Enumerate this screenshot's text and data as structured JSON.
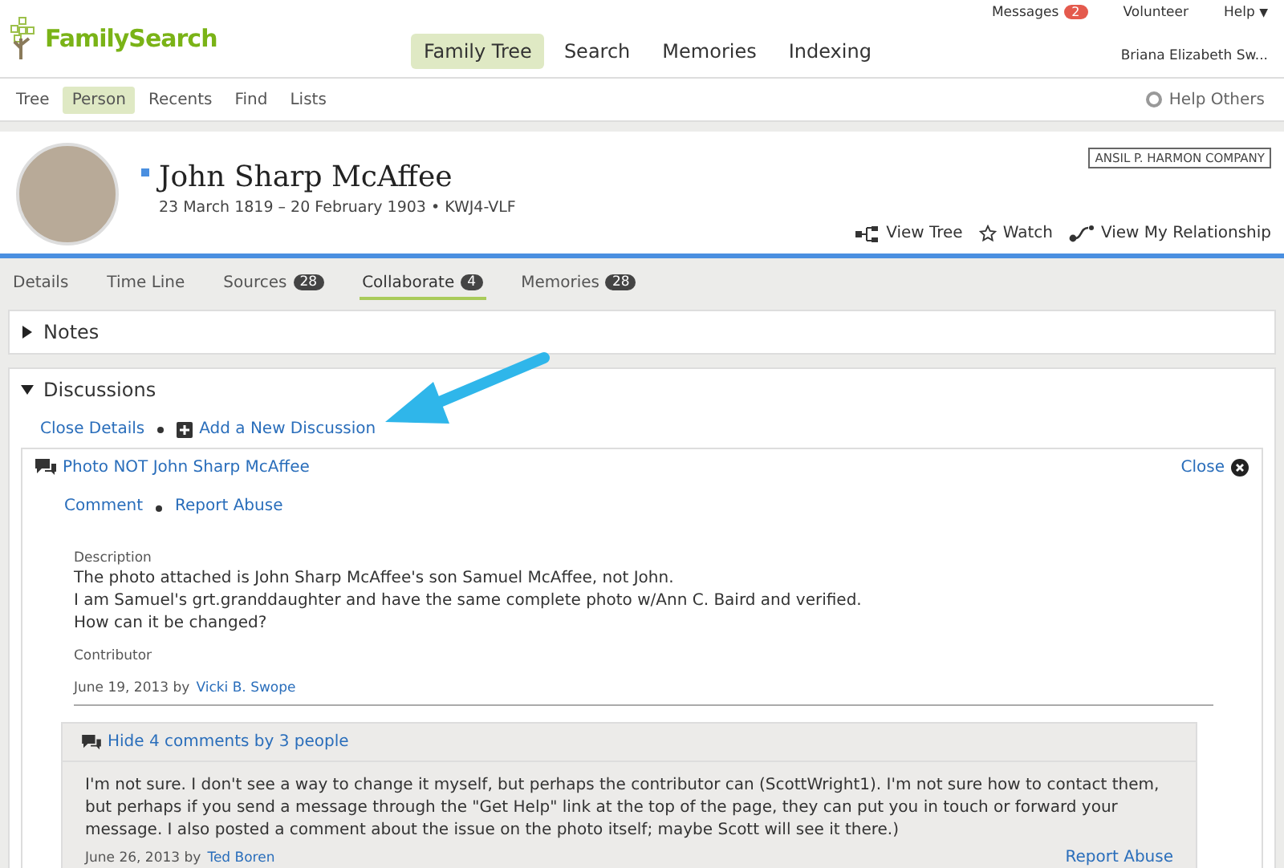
{
  "header": {
    "logo": "FamilySearch",
    "nav": [
      {
        "label": "Family Tree",
        "selected": true
      },
      {
        "label": "Search",
        "selected": false
      },
      {
        "label": "Memories",
        "selected": false
      },
      {
        "label": "Indexing",
        "selected": false
      }
    ],
    "top_links": [
      {
        "label": "Messages",
        "badge": "2"
      },
      {
        "label": "Volunteer"
      },
      {
        "label": "Help",
        "caret": "▼"
      }
    ],
    "user": "Briana Elizabeth Sw..."
  },
  "subnav": {
    "items": [
      {
        "label": "Tree",
        "selected": false
      },
      {
        "label": "Person",
        "selected": true
      },
      {
        "label": "Recents",
        "selected": false
      },
      {
        "label": "Find",
        "selected": false
      },
      {
        "label": "Lists",
        "selected": false
      }
    ],
    "help": "Help Others"
  },
  "person": {
    "name": "John Sharp McAffee",
    "dates": "23 March 1819 – 20 February 1903 • KWJ4-VLF",
    "stamp": "ANSIL P. HARMON COMPANY",
    "actions": [
      {
        "kind": "tree",
        "label": "View Tree"
      },
      {
        "kind": "watch",
        "label": "Watch"
      },
      {
        "kind": "relationship",
        "label": "View My Relationship"
      }
    ]
  },
  "tabs": [
    {
      "label": "Details",
      "selected": false
    },
    {
      "label": "Time Line",
      "selected": false
    },
    {
      "label": "Sources",
      "count": "28",
      "selected": false
    },
    {
      "label": "Collaborate",
      "count": "4",
      "selected": true
    },
    {
      "label": "Memories",
      "count": "28",
      "selected": false
    }
  ],
  "sections": [
    {
      "title": "Notes",
      "expanded": false
    },
    {
      "title": "Discussions",
      "expanded": true
    }
  ],
  "discussions": {
    "close_details": "Close Details",
    "add_new": "Add a New Discussion",
    "items": [
      {
        "title": "Photo NOT John Sharp McAffee",
        "close": "Close",
        "actions": [
          "Comment",
          "Report Abuse"
        ],
        "description_label": "Description",
        "description": [
          "The photo attached is John Sharp McAffee's son Samuel McAffee, not John.",
          "I am Samuel's grt.granddaughter and have the same complete photo w/Ann C. Baird and verified.",
          "How can it be changed?"
        ],
        "contributor_label": "Contributor",
        "date": "June 19, 2013 by",
        "author": "Vicki B. Swope",
        "comments_toggle": "Hide 4 comments by 3 people",
        "comments": [
          {
            "text": "I'm not sure. I don't see a way to change it myself, but perhaps the contributor can (ScottWright1). I'm not sure how to contact them, but perhaps if you send a message through the \"Get Help\" link at the top of the page, they can put you in touch or forward your message. I also posted a comment about the issue on the photo itself; maybe Scott will see it there.)",
            "date": "June 26, 2013 by",
            "author": "Ted Boren",
            "report": "Report Abuse"
          }
        ]
      }
    ]
  }
}
